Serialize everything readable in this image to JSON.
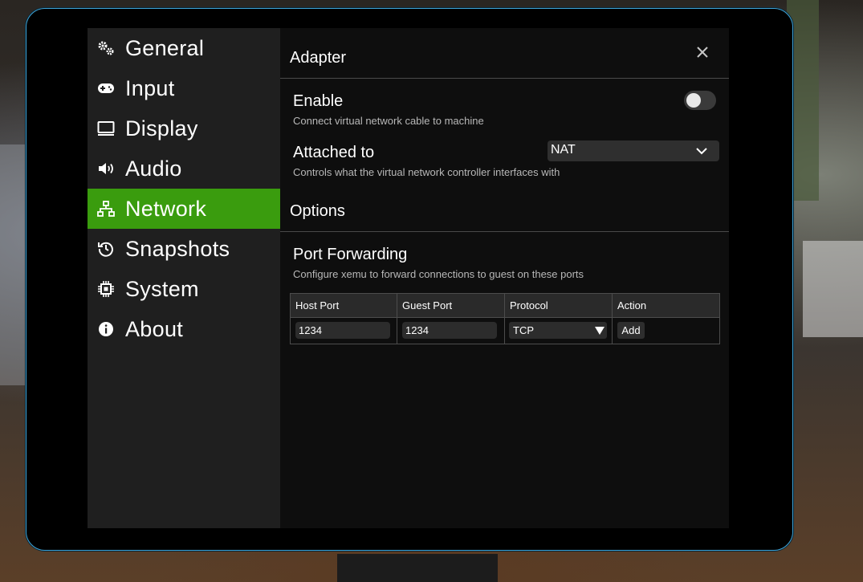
{
  "sidebar": {
    "items": [
      {
        "label": "General",
        "icon": "gears-icon"
      },
      {
        "label": "Input",
        "icon": "gamepad-icon"
      },
      {
        "label": "Display",
        "icon": "monitor-icon"
      },
      {
        "label": "Audio",
        "icon": "speaker-icon"
      },
      {
        "label": "Network",
        "icon": "network-icon",
        "active": true
      },
      {
        "label": "Snapshots",
        "icon": "history-icon"
      },
      {
        "label": "System",
        "icon": "chip-icon"
      },
      {
        "label": "About",
        "icon": "info-icon"
      }
    ]
  },
  "content": {
    "adapter_title": "Adapter",
    "enable": {
      "title": "Enable",
      "description": "Connect virtual network cable to machine",
      "value": false
    },
    "attached_to": {
      "title": "Attached to",
      "description": "Controls what the virtual network controller interfaces with",
      "selected": "NAT"
    },
    "options_title": "Options",
    "port_forwarding": {
      "title": "Port Forwarding",
      "description": "Configure xemu to forward connections to guest on these ports",
      "columns": [
        "Host Port",
        "Guest Port",
        "Protocol",
        "Action"
      ],
      "row": {
        "host_port": "1234",
        "guest_port": "1234",
        "protocol": "TCP",
        "action": "Add"
      }
    }
  },
  "colors": {
    "accent": "#3a9c0e",
    "window_border": "#3fa3d6",
    "sidebar_bg": "#1f1f1f",
    "content_bg": "#0e0e0e"
  }
}
